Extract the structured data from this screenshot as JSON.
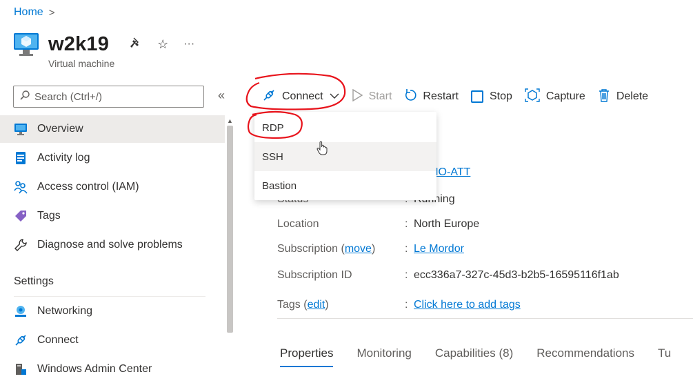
{
  "breadcrumb": {
    "home": "Home",
    "separator": ">"
  },
  "header": {
    "title": "w2k19",
    "subtitle": "Virtual machine",
    "pin_glyph": "📌",
    "star_glyph": "☆",
    "more_glyph": "···"
  },
  "search": {
    "placeholder": "Search (Ctrl+/)",
    "collapse_glyph": "«"
  },
  "sidebar": {
    "items": [
      {
        "label": "Overview",
        "icon": "monitor-icon"
      },
      {
        "label": "Activity log",
        "icon": "log-icon"
      },
      {
        "label": "Access control (IAM)",
        "icon": "people-icon"
      },
      {
        "label": "Tags",
        "icon": "tag-icon"
      },
      {
        "label": "Diagnose and solve problems",
        "icon": "wrench-icon"
      }
    ],
    "section_settings": "Settings",
    "settings_items": [
      {
        "label": "Networking",
        "icon": "network-icon"
      },
      {
        "label": "Connect",
        "icon": "plug-icon"
      },
      {
        "label": "Windows Admin Center",
        "icon": "server-icon"
      }
    ]
  },
  "toolbar": {
    "connect": "Connect",
    "start": "Start",
    "restart": "Restart",
    "stop": "Stop",
    "capture": "Capture",
    "delete": "Delete"
  },
  "connect_menu": {
    "items": [
      "RDP",
      "SSH",
      "Bastion"
    ],
    "hovered": "SSH"
  },
  "essentials": {
    "resource_group_value": "DEMO-ATT",
    "status_label": "Status",
    "status_value": "Running",
    "location_label": "Location",
    "location_value": "North Europe",
    "subscription_label": "Subscription",
    "subscription_move": "move",
    "subscription_value": "Le Mordor",
    "subscription_id_label": "Subscription ID",
    "subscription_id_value": "ecc336a7-327c-45d3-b2b5-16595116f1ab",
    "tags_label": "Tags",
    "tags_edit": "edit",
    "tags_value": "Click here to add tags",
    "colon": ":"
  },
  "tabs": [
    "Properties",
    "Monitoring",
    "Capabilities (8)",
    "Recommendations",
    "Tu"
  ],
  "colors": {
    "accent": "#0078d4",
    "annotation": "#e8141c",
    "selected_bg": "#edebe9"
  }
}
